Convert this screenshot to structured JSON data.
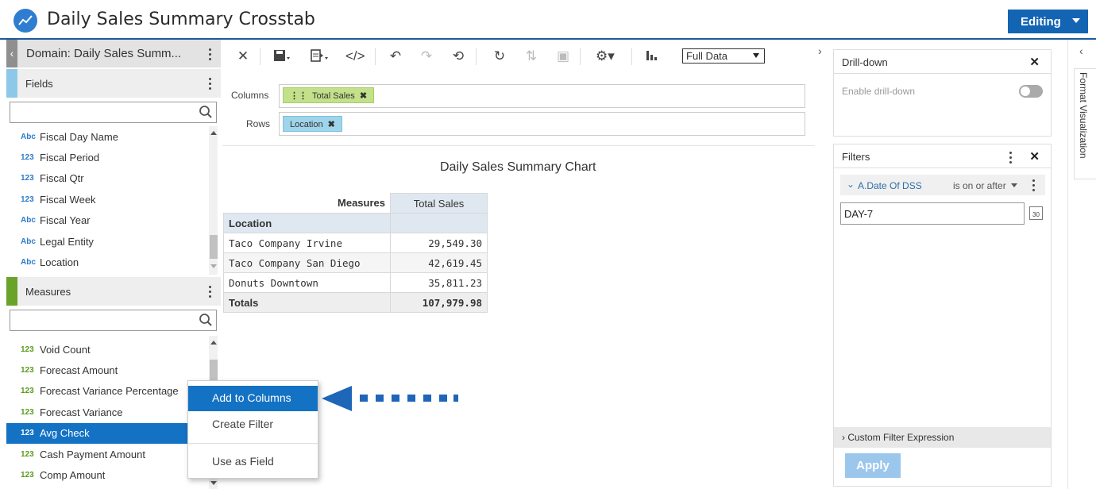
{
  "header": {
    "title": "Daily Sales Summary Crosstab",
    "editing_label": "Editing"
  },
  "left": {
    "domain_label": "Domain: Daily Sales Summ...",
    "fields_label": "Fields",
    "fields": [
      {
        "type": "Abc",
        "name": "Fiscal Day Name"
      },
      {
        "type": "123",
        "name": "Fiscal Period"
      },
      {
        "type": "123",
        "name": "Fiscal Qtr"
      },
      {
        "type": "123",
        "name": "Fiscal Week"
      },
      {
        "type": "Abc",
        "name": "Fiscal Year"
      },
      {
        "type": "Abc",
        "name": "Legal Entity"
      },
      {
        "type": "Abc",
        "name": "Location"
      }
    ],
    "measures_label": "Measures",
    "measures": [
      {
        "type": "123",
        "name": "Void Count"
      },
      {
        "type": "123",
        "name": "Forecast Amount"
      },
      {
        "type": "123",
        "name": "Forecast Variance Percentage"
      },
      {
        "type": "123",
        "name": "Forecast Variance"
      },
      {
        "type": "123",
        "name": "Avg Check"
      },
      {
        "type": "123",
        "name": "Cash Payment Amount"
      },
      {
        "type": "123",
        "name": "Comp Amount"
      }
    ],
    "fields_search_placeholder": "",
    "measures_search_placeholder": ""
  },
  "toolbar": {
    "data_mode": "Full Data"
  },
  "shelves": {
    "columns_label": "Columns",
    "rows_label": "Rows",
    "columns_pill": "Total Sales",
    "rows_pill": "Location"
  },
  "report": {
    "chart_title": "Daily Sales Summary Chart",
    "measures_header": "Measures",
    "value_header": "Total Sales",
    "row_header": "Location",
    "rows": [
      {
        "name": "Taco Company Irvine",
        "value": "29,549.30"
      },
      {
        "name": "Taco Company San Diego",
        "value": "42,619.45"
      },
      {
        "name": "Donuts Downtown",
        "value": "35,811.23"
      }
    ],
    "totals_label": "Totals",
    "totals_value": "107,979.98"
  },
  "right": {
    "drilldown_title": "Drill-down",
    "enable_drilldown": "Enable drill-down",
    "filters_title": "Filters",
    "filter_field": "A.Date Of DSS",
    "filter_operator": "is on or after",
    "filter_value": "DAY-7",
    "calendar_day": "30",
    "custom_expression": "Custom Filter Expression",
    "apply_label": "Apply",
    "side_tab": "Format Visualization"
  },
  "context_menu": {
    "add_columns": "Add to Columns",
    "create_filter": "Create Filter",
    "use_as_field": "Use as Field"
  },
  "colors": {
    "accent": "#1464b4",
    "selected": "#1472c4",
    "fields_accent": "#8ec8e8",
    "measures_accent": "#6aa32a"
  }
}
